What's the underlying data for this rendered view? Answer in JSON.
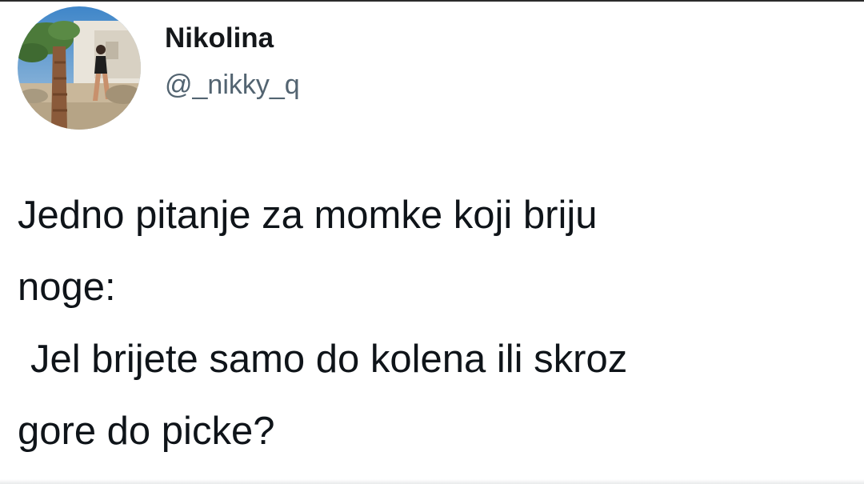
{
  "tweet": {
    "author": {
      "display_name": "Nikolina",
      "handle": "@_nikky_q",
      "avatar_icon": "profile-photo-icon"
    },
    "text_lines": [
      "Jedno pitanje za momke koji briju",
      "noge:",
      "Jel brijete samo do kolena ili skroz",
      "gore do picke?"
    ]
  }
}
